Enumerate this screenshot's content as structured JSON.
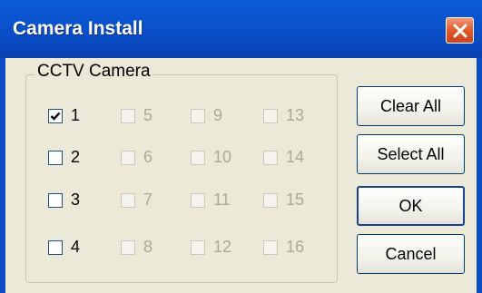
{
  "window": {
    "title": "Camera Install"
  },
  "group": {
    "label": "CCTV Camera"
  },
  "cameras": [
    {
      "label": "1",
      "checked": true,
      "enabled": true
    },
    {
      "label": "2",
      "checked": false,
      "enabled": true
    },
    {
      "label": "3",
      "checked": false,
      "enabled": true
    },
    {
      "label": "4",
      "checked": false,
      "enabled": true
    },
    {
      "label": "5",
      "checked": false,
      "enabled": false
    },
    {
      "label": "6",
      "checked": false,
      "enabled": false
    },
    {
      "label": "7",
      "checked": false,
      "enabled": false
    },
    {
      "label": "8",
      "checked": false,
      "enabled": false
    },
    {
      "label": "9",
      "checked": false,
      "enabled": false
    },
    {
      "label": "10",
      "checked": false,
      "enabled": false
    },
    {
      "label": "11",
      "checked": false,
      "enabled": false
    },
    {
      "label": "12",
      "checked": false,
      "enabled": false
    },
    {
      "label": "13",
      "checked": false,
      "enabled": false
    },
    {
      "label": "14",
      "checked": false,
      "enabled": false
    },
    {
      "label": "15",
      "checked": false,
      "enabled": false
    },
    {
      "label": "16",
      "checked": false,
      "enabled": false
    }
  ],
  "buttons": {
    "clear_all": "Clear All",
    "select_all": "Select All",
    "ok": "OK",
    "cancel": "Cancel"
  },
  "colors": {
    "titlebar": "#0a52cc",
    "close": "#e05a2b",
    "dialog_bg": "#ece9d8"
  },
  "icons": {
    "close": "close-icon",
    "check": "checkmark-icon"
  }
}
